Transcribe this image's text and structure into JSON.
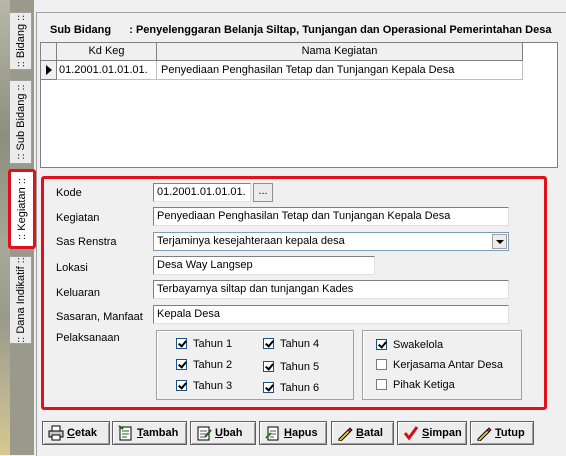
{
  "side_tabs": [
    {
      "label": ":: Bidang ::"
    },
    {
      "label": ":: Sub Bidang ::"
    },
    {
      "label": ":: Kegiatan ::"
    },
    {
      "label": ":: Dana Indikatif ::"
    }
  ],
  "header": {
    "label": "Sub Bidang",
    "separator": ":",
    "value": "Penyelenggaran Belanja Siltap, Tunjangan dan Operasional Pemerintahan Desa"
  },
  "grid": {
    "columns": [
      "Kd Keg",
      "Nama Kegiatan"
    ],
    "rows": [
      {
        "kd_keg": "01.2001.01.01.01.",
        "nama_kegiatan": "Penyediaan Penghasilan Tetap dan Tunjangan Kepala Desa"
      }
    ]
  },
  "form": {
    "kode": {
      "label": "Kode",
      "value": "01.2001.01.01.01.",
      "lookup_label": "..."
    },
    "kegiatan": {
      "label": "Kegiatan",
      "value": "Penyediaan Penghasilan Tetap dan Tunjangan Kepala Desa"
    },
    "sas_renstra": {
      "label": "Sas Renstra",
      "value": "Terjaminya kesejahteraan kepala desa"
    },
    "lokasi": {
      "label": "Lokasi",
      "value": "Desa Way Langsep"
    },
    "keluaran": {
      "label": "Keluaran",
      "value": "Terbayarnya siltap dan tunjangan Kades"
    },
    "sasaran": {
      "label": "Sasaran, Manfaat",
      "value": "Kepala Desa"
    },
    "pelaksanaan": {
      "label": "Pelaksanaan"
    },
    "tahun": [
      {
        "label": "Tahun 1",
        "checked": true
      },
      {
        "label": "Tahun 2",
        "checked": true
      },
      {
        "label": "Tahun 3",
        "checked": true
      },
      {
        "label": "Tahun 4",
        "checked": true
      },
      {
        "label": "Tahun 5",
        "checked": true
      },
      {
        "label": "Tahun 6",
        "checked": true
      }
    ],
    "jenis": [
      {
        "label": "Swakelola",
        "checked": true
      },
      {
        "label": "Kerjasama Antar Desa",
        "checked": false
      },
      {
        "label": "Pihak Ketiga",
        "checked": false
      }
    ]
  },
  "toolbar": {
    "cetak": {
      "hot": "C",
      "rest": "etak"
    },
    "tambah": {
      "hot": "T",
      "rest": "ambah"
    },
    "ubah": {
      "hot": "U",
      "rest": "bah"
    },
    "hapus": {
      "hot": "H",
      "rest": "apus"
    },
    "batal": {
      "hot": "B",
      "rest": "atal"
    },
    "simpan": {
      "hot": "S",
      "rest": "impan"
    },
    "tutup": {
      "hot": "T",
      "rest": "utup"
    }
  },
  "colors": {
    "highlight": "#e0101c",
    "field_border": "#7f9db9"
  }
}
